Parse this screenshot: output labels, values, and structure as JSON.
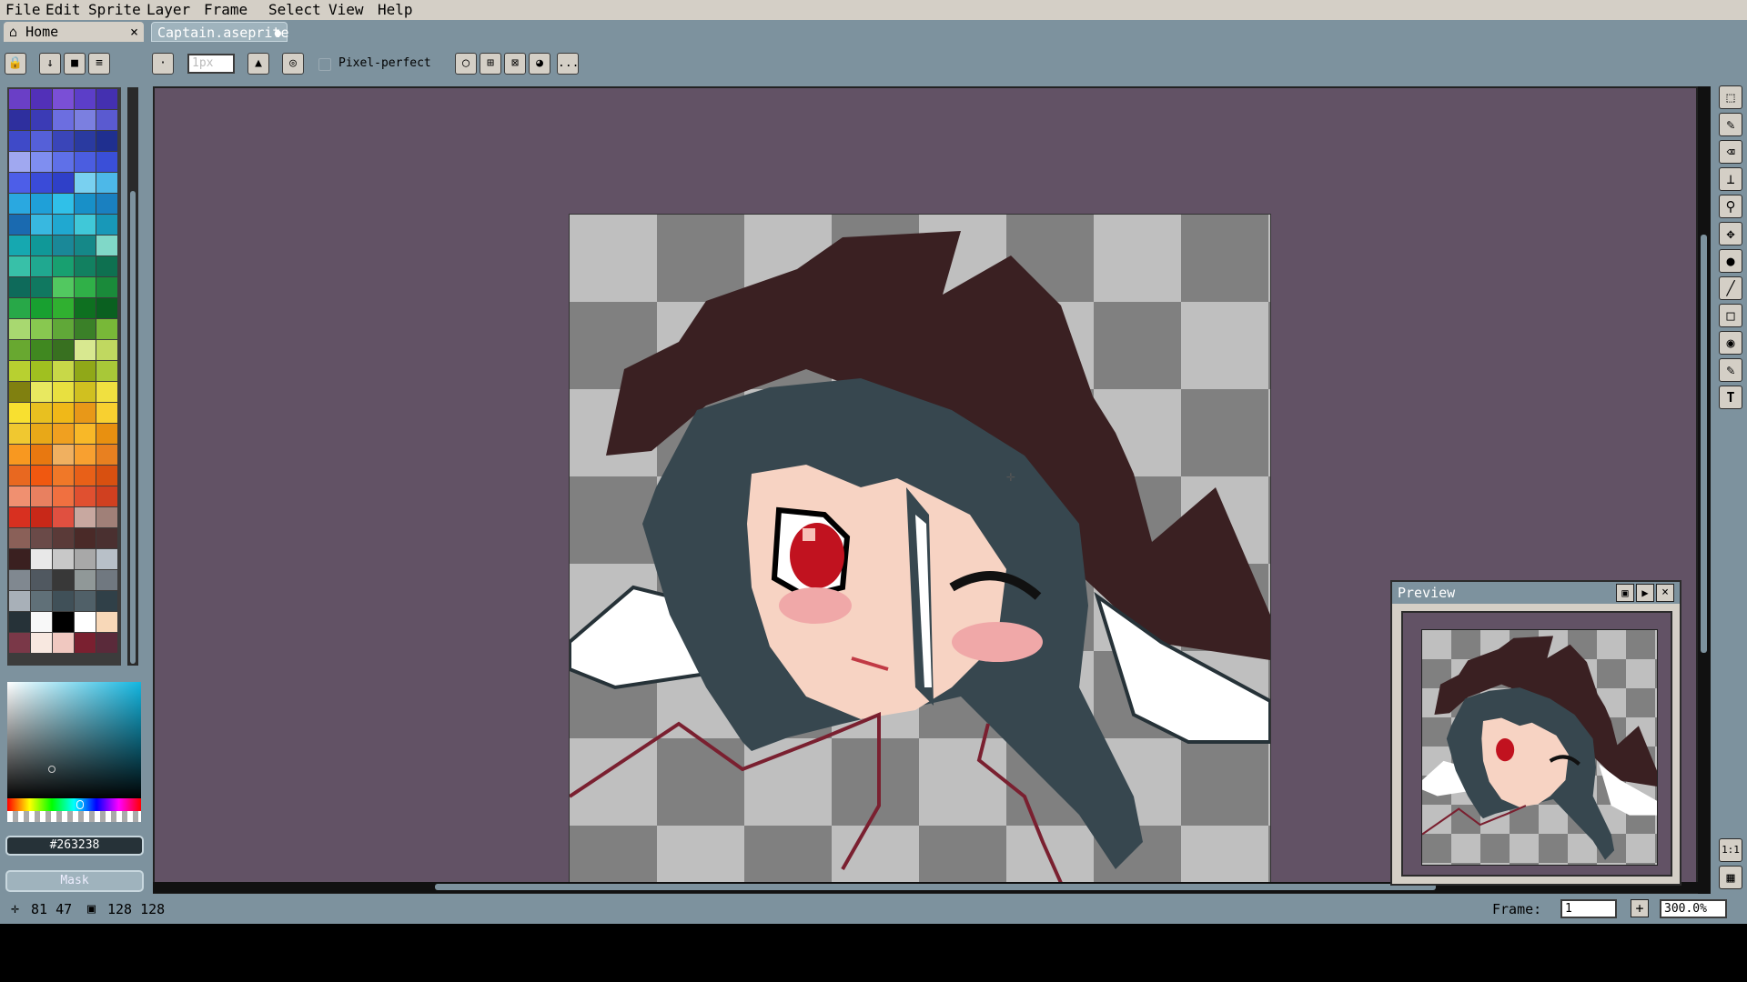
{
  "menu": {
    "items": [
      "File",
      "Edit",
      "Sprite",
      "Layer",
      "Frame",
      "Select",
      "View",
      "Help"
    ]
  },
  "tabs": {
    "home": "Home",
    "document": "Captain.aseprite"
  },
  "toolbar": {
    "brush_size": "1px",
    "pixel_perfect_label": "Pixel-perfect",
    "more_label": "..."
  },
  "palette": {
    "colors": [
      "#6a3fc6",
      "#5230b8",
      "#7a4fd6",
      "#5c3ec8",
      "#4430b0",
      "#2e2f9e",
      "#3b3bb5",
      "#6c6ee0",
      "#7b7fe0",
      "#5a5ad0",
      "#3f4ac8",
      "#5560d8",
      "#3a45b8",
      "#2a3aa0",
      "#1f2f8f",
      "#a0a8f0",
      "#7f8ef0",
      "#5f70e8",
      "#4b5de0",
      "#3a4fd8",
      "#4d5ee8",
      "#3a4bd8",
      "#2f40c8",
      "#79d0f0",
      "#4db8e8",
      "#2aa8e0",
      "#1fa0d8",
      "#30c0e8",
      "#1890c8",
      "#1a80c0",
      "#1a6ab0",
      "#38b8e0",
      "#20a8d0",
      "#40c8d8",
      "#1898b8",
      "#16a8b0",
      "#109898",
      "#1a8898",
      "#158888",
      "#80d8c8",
      "#38c0a8",
      "#20a890",
      "#18a070",
      "#128060",
      "#0e7050",
      "#0e6a5a",
      "#107860",
      "#52c860",
      "#30b048",
      "#1a8a3a",
      "#28a848",
      "#18a030",
      "#30b030",
      "#0e7020",
      "#0a6020",
      "#a8d870",
      "#88c850",
      "#60a838",
      "#3a8028",
      "#78b838",
      "#68a830",
      "#408820",
      "#387020",
      "#d8e890",
      "#c0d860",
      "#b8d030",
      "#a0c020",
      "#c8d848",
      "#90a818",
      "#a8c838",
      "#808010",
      "#e8e860",
      "#e8e040",
      "#d0c020",
      "#f0e040",
      "#f8e030",
      "#e8c020",
      "#f0b818",
      "#e89818",
      "#f8d030",
      "#f0c830",
      "#e8a818",
      "#f0a020",
      "#f8b828",
      "#e89010",
      "#f89820",
      "#e87810",
      "#f0b060",
      "#f8a030",
      "#e88020",
      "#e86820",
      "#f05810",
      "#f07828",
      "#e86018",
      "#d85010",
      "#f09070",
      "#e88060",
      "#f07040",
      "#e05030",
      "#d04020",
      "#d83020",
      "#c82818",
      "#e05040",
      "#c8a8a0",
      "#a08078",
      "#8a6058",
      "#6a4a48",
      "#5a3a38",
      "#4a2a28",
      "#4a3030",
      "#3a2020",
      "#e8e8e8",
      "#c8c8c8",
      "#a8a8a8",
      "#b8c0c8",
      "#808890",
      "#505860",
      "#383838",
      "#909898",
      "#707880",
      "#a8b0b8",
      "#607078",
      "#405058",
      "#506068",
      "#304048",
      "#263238",
      "#f8f8f8",
      "#000000",
      "#ffffff",
      "#f8d8b8",
      "#7a3848",
      "#f8e8e0",
      "#f0c8c0",
      "#7a2030",
      "#5a2a3a"
    ]
  },
  "color_picker": {
    "hex_value": "#263238",
    "mask_label": "Mask"
  },
  "preview": {
    "title": "Preview"
  },
  "status": {
    "cursor_pos": "81 47",
    "sprite_size": "128 128",
    "frame_label": "Frame:",
    "frame_value": "1",
    "zoom": "300.0%"
  },
  "colors": {
    "hair": "#37474f",
    "hat": "#3a2022",
    "skin": "#f7d3c3",
    "eye": "#c1121f",
    "canvas_bg": "#625265",
    "ui_face": "#d4cfc6",
    "ui_frame": "#7d929e"
  }
}
